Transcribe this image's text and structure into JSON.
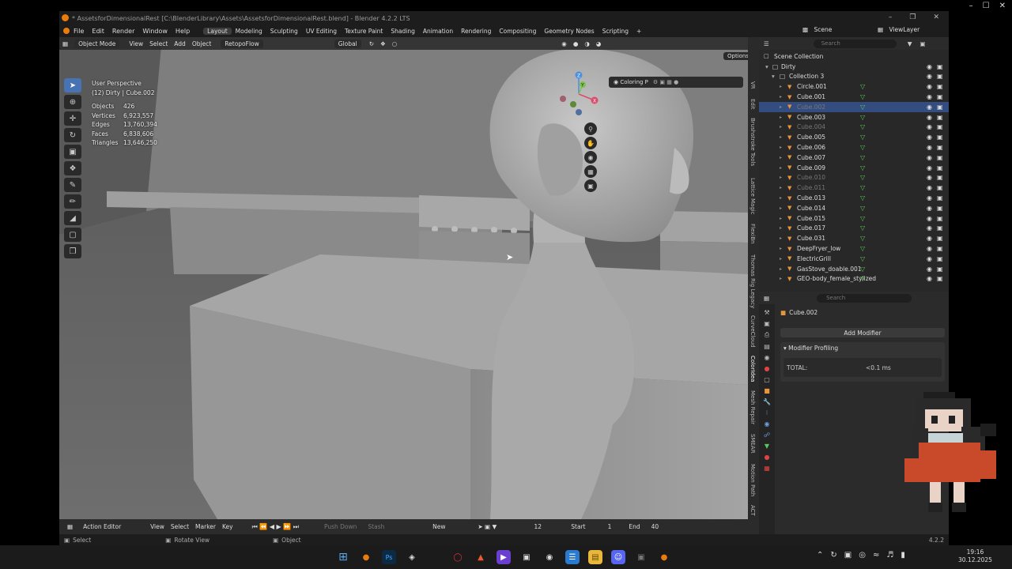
{
  "window": {
    "title": "* AssetsforDimensionalRest [C:\\BlenderLibrary\\Assets\\AssetsforDimensionalRest.blend] - Blender 4.2.2 LTS",
    "outer_minimize": "–",
    "outer_maximize": "☐",
    "outer_close": "✕",
    "app_minimize": "–",
    "app_maximize": "❐",
    "app_close": "✕"
  },
  "menu": [
    "File",
    "Edit",
    "Render",
    "Window",
    "Help"
  ],
  "workspaces": [
    "Layout",
    "Modeling",
    "Sculpting",
    "UV Editing",
    "Texture Paint",
    "Shading",
    "Animation",
    "Rendering",
    "Compositing",
    "Geometry Nodes",
    "Scripting",
    "+"
  ],
  "active_workspace": "Layout",
  "top_right": {
    "scene": "Scene",
    "viewlayer": "ViewLayer"
  },
  "viewport": {
    "mode": "Object Mode",
    "menus": [
      "View",
      "Select",
      "Add",
      "Object"
    ],
    "retopo": "RetopoFlow",
    "transform": "Global",
    "options": "Options",
    "coloring": "Coloring P",
    "perspective": "User Perspective",
    "context": "(12) Dirty | Cube.002",
    "stats": [
      {
        "k": "Objects",
        "v": "426"
      },
      {
        "k": "Vertices",
        "v": "6,923,557"
      },
      {
        "k": "Edges",
        "v": "13,760,394"
      },
      {
        "k": "Faces",
        "v": "6,838,606"
      },
      {
        "k": "Triangles",
        "v": "13,646,250"
      }
    ],
    "gizmo": {
      "z": "Z",
      "y": "Y",
      "x": "X"
    }
  },
  "sidebar_tabs": [
    "VR",
    "Edit",
    "Brushstroke Tools",
    "Lattice Magic",
    "FlexiBn",
    "Thomas Rig Legacy",
    "CurveCloud",
    "ColorIdea",
    "Mesh Repair",
    "SMEAR",
    "Motion Path",
    "ACT"
  ],
  "outliner": {
    "search": "Search",
    "root": "Scene Collection",
    "dirty": "Dirty",
    "collection": "Collection 3",
    "items": [
      {
        "name": "Circle.001",
        "dim": false,
        "sel": false
      },
      {
        "name": "Cube.001",
        "dim": false,
        "sel": false
      },
      {
        "name": "Cube.002",
        "dim": true,
        "sel": true
      },
      {
        "name": "Cube.003",
        "dim": false,
        "sel": false
      },
      {
        "name": "Cube.004",
        "dim": true,
        "sel": false
      },
      {
        "name": "Cube.005",
        "dim": false,
        "sel": false
      },
      {
        "name": "Cube.006",
        "dim": false,
        "sel": false
      },
      {
        "name": "Cube.007",
        "dim": false,
        "sel": false
      },
      {
        "name": "Cube.009",
        "dim": false,
        "sel": false
      },
      {
        "name": "Cube.010",
        "dim": true,
        "sel": false
      },
      {
        "name": "Cube.011",
        "dim": true,
        "sel": false
      },
      {
        "name": "Cube.013",
        "dim": false,
        "sel": false
      },
      {
        "name": "Cube.014",
        "dim": false,
        "sel": false
      },
      {
        "name": "Cube.015",
        "dim": false,
        "sel": false
      },
      {
        "name": "Cube.017",
        "dim": false,
        "sel": false
      },
      {
        "name": "Cube.031",
        "dim": false,
        "sel": false
      },
      {
        "name": "DeepFryer_low",
        "dim": false,
        "sel": false
      },
      {
        "name": "ElectricGrill",
        "dim": false,
        "sel": false
      },
      {
        "name": "GasStove_doable.001",
        "dim": false,
        "sel": false
      },
      {
        "name": "GEO-body_female_stylized",
        "dim": false,
        "sel": false
      }
    ]
  },
  "properties": {
    "search": "Search",
    "object": "Cube.002",
    "add_modifier": "Add Modifier",
    "panel": "Modifier Profiling",
    "total_label": "TOTAL:",
    "total_value": "<0.1 ms"
  },
  "timeline": {
    "editor": "Action Editor",
    "menus": [
      "View",
      "Select",
      "Marker",
      "Key"
    ],
    "push_down": "Push Down",
    "stash": "Stash",
    "new": "New",
    "frame": "12",
    "start_label": "Start",
    "start": "1",
    "end_label": "End",
    "end": "40"
  },
  "status": {
    "select": "Select",
    "rotate": "Rotate View",
    "object": "Object",
    "version": "4.2.2"
  },
  "taskbar": {
    "time": "19:16",
    "date": "30.12.2025"
  }
}
